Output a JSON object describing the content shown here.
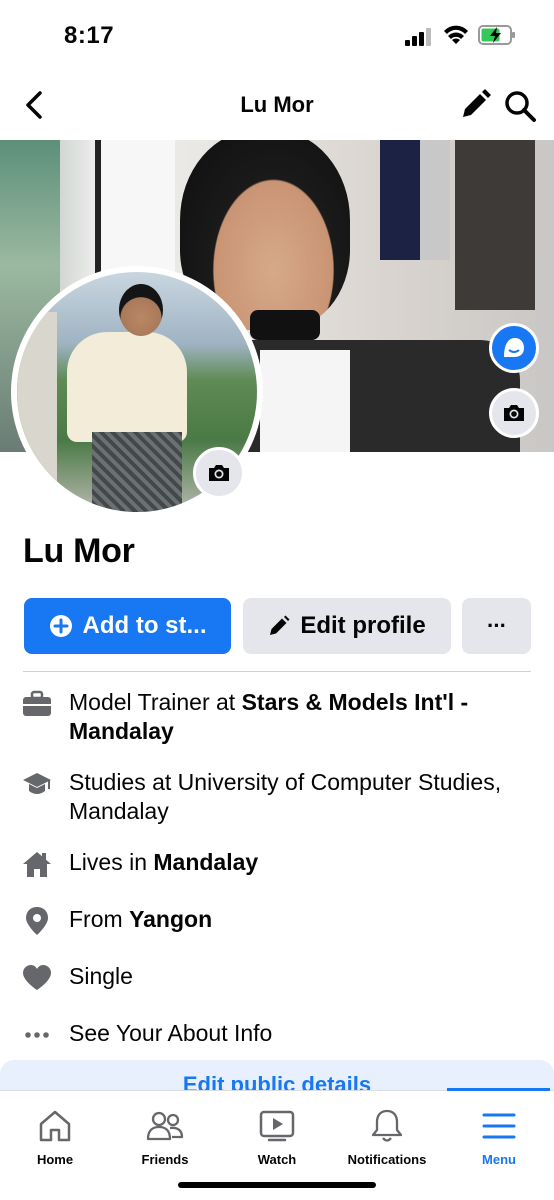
{
  "status_bar": {
    "time": "8:17"
  },
  "header": {
    "title": "Lu Mor"
  },
  "profile": {
    "name": "Lu Mor"
  },
  "actions": {
    "add_story_label": "Add to st...",
    "edit_profile_label": "Edit profile",
    "more_label": "···"
  },
  "details": [
    {
      "icon": "briefcase-icon",
      "prefix": "Model Trainer at ",
      "bold": "Stars & Models Int'l  - Mandalay"
    },
    {
      "icon": "graduation-cap-icon",
      "prefix": "Studies at University of Computer Studies, Mandalay",
      "bold": ""
    },
    {
      "icon": "house-icon",
      "prefix": "Lives in ",
      "bold": "Mandalay"
    },
    {
      "icon": "location-pin-icon",
      "prefix": "From ",
      "bold": "Yangon"
    },
    {
      "icon": "heart-icon",
      "prefix": "Single",
      "bold": ""
    },
    {
      "icon": "more-dots-icon",
      "prefix": "See Your About Info",
      "bold": ""
    }
  ],
  "edit_public_details_label": "Edit public details",
  "tabs": [
    {
      "label": "Home",
      "icon": "home-icon"
    },
    {
      "label": "Friends",
      "icon": "friends-icon"
    },
    {
      "label": "Watch",
      "icon": "watch-icon"
    },
    {
      "label": "Notifications",
      "icon": "bell-icon"
    },
    {
      "label": "Menu",
      "icon": "menu-icon",
      "active": true
    }
  ],
  "colors": {
    "accent": "#1877f2",
    "button_gray": "#e4e6eb",
    "text": "#050505"
  }
}
